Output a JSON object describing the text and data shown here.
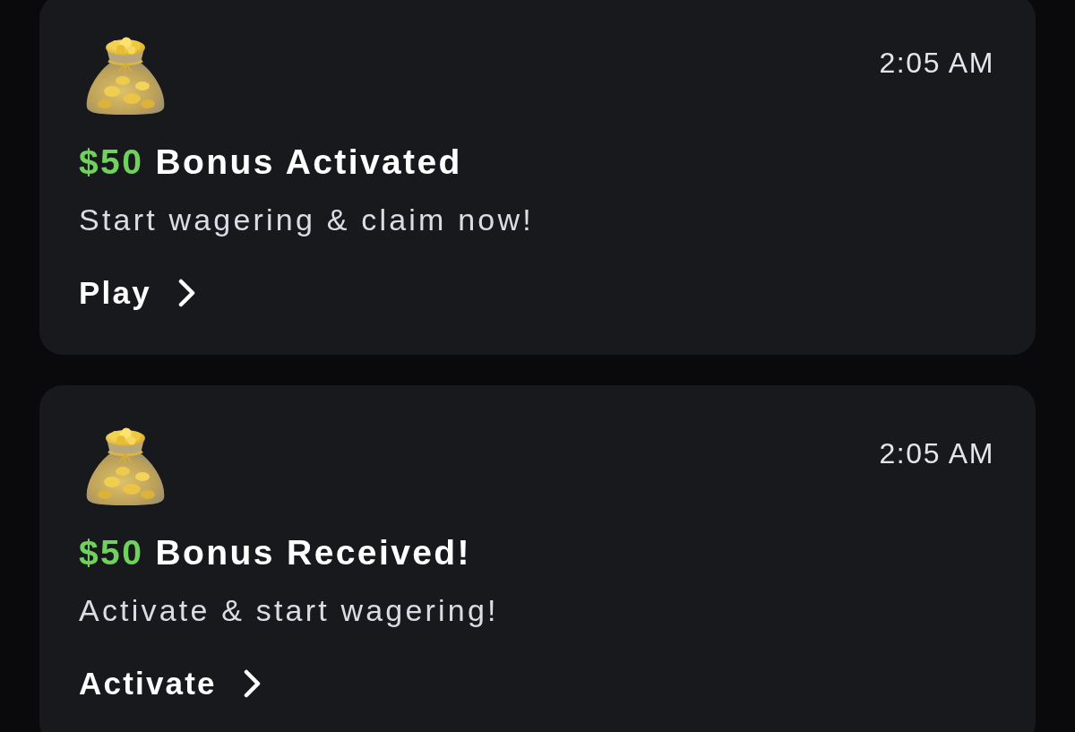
{
  "notifications": [
    {
      "time": "2:05 AM",
      "amount": "$50",
      "title": "Bonus Activated",
      "message": "Start wagering & claim now!",
      "action": "Play"
    },
    {
      "time": "2:05 AM",
      "amount": "$50",
      "title": "Bonus Received!",
      "message": "Activate & start wagering!",
      "action": "Activate"
    }
  ]
}
